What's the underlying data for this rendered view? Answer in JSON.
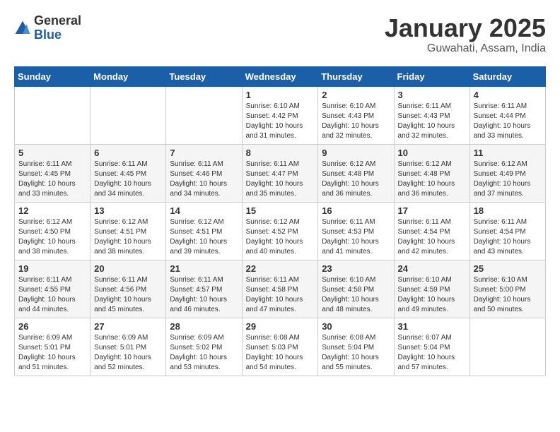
{
  "header": {
    "logo_general": "General",
    "logo_blue": "Blue",
    "month_title": "January 2025",
    "location": "Guwahati, Assam, India"
  },
  "weekdays": [
    "Sunday",
    "Monday",
    "Tuesday",
    "Wednesday",
    "Thursday",
    "Friday",
    "Saturday"
  ],
  "weeks": [
    [
      {
        "day": "",
        "info": ""
      },
      {
        "day": "",
        "info": ""
      },
      {
        "day": "",
        "info": ""
      },
      {
        "day": "1",
        "info": "Sunrise: 6:10 AM\nSunset: 4:42 PM\nDaylight: 10 hours\nand 31 minutes."
      },
      {
        "day": "2",
        "info": "Sunrise: 6:10 AM\nSunset: 4:43 PM\nDaylight: 10 hours\nand 32 minutes."
      },
      {
        "day": "3",
        "info": "Sunrise: 6:11 AM\nSunset: 4:43 PM\nDaylight: 10 hours\nand 32 minutes."
      },
      {
        "day": "4",
        "info": "Sunrise: 6:11 AM\nSunset: 4:44 PM\nDaylight: 10 hours\nand 33 minutes."
      }
    ],
    [
      {
        "day": "5",
        "info": "Sunrise: 6:11 AM\nSunset: 4:45 PM\nDaylight: 10 hours\nand 33 minutes."
      },
      {
        "day": "6",
        "info": "Sunrise: 6:11 AM\nSunset: 4:45 PM\nDaylight: 10 hours\nand 34 minutes."
      },
      {
        "day": "7",
        "info": "Sunrise: 6:11 AM\nSunset: 4:46 PM\nDaylight: 10 hours\nand 34 minutes."
      },
      {
        "day": "8",
        "info": "Sunrise: 6:11 AM\nSunset: 4:47 PM\nDaylight: 10 hours\nand 35 minutes."
      },
      {
        "day": "9",
        "info": "Sunrise: 6:12 AM\nSunset: 4:48 PM\nDaylight: 10 hours\nand 36 minutes."
      },
      {
        "day": "10",
        "info": "Sunrise: 6:12 AM\nSunset: 4:48 PM\nDaylight: 10 hours\nand 36 minutes."
      },
      {
        "day": "11",
        "info": "Sunrise: 6:12 AM\nSunset: 4:49 PM\nDaylight: 10 hours\nand 37 minutes."
      }
    ],
    [
      {
        "day": "12",
        "info": "Sunrise: 6:12 AM\nSunset: 4:50 PM\nDaylight: 10 hours\nand 38 minutes."
      },
      {
        "day": "13",
        "info": "Sunrise: 6:12 AM\nSunset: 4:51 PM\nDaylight: 10 hours\nand 38 minutes."
      },
      {
        "day": "14",
        "info": "Sunrise: 6:12 AM\nSunset: 4:51 PM\nDaylight: 10 hours\nand 39 minutes."
      },
      {
        "day": "15",
        "info": "Sunrise: 6:12 AM\nSunset: 4:52 PM\nDaylight: 10 hours\nand 40 minutes."
      },
      {
        "day": "16",
        "info": "Sunrise: 6:11 AM\nSunset: 4:53 PM\nDaylight: 10 hours\nand 41 minutes."
      },
      {
        "day": "17",
        "info": "Sunrise: 6:11 AM\nSunset: 4:54 PM\nDaylight: 10 hours\nand 42 minutes."
      },
      {
        "day": "18",
        "info": "Sunrise: 6:11 AM\nSunset: 4:54 PM\nDaylight: 10 hours\nand 43 minutes."
      }
    ],
    [
      {
        "day": "19",
        "info": "Sunrise: 6:11 AM\nSunset: 4:55 PM\nDaylight: 10 hours\nand 44 minutes."
      },
      {
        "day": "20",
        "info": "Sunrise: 6:11 AM\nSunset: 4:56 PM\nDaylight: 10 hours\nand 45 minutes."
      },
      {
        "day": "21",
        "info": "Sunrise: 6:11 AM\nSunset: 4:57 PM\nDaylight: 10 hours\nand 46 minutes."
      },
      {
        "day": "22",
        "info": "Sunrise: 6:11 AM\nSunset: 4:58 PM\nDaylight: 10 hours\nand 47 minutes."
      },
      {
        "day": "23",
        "info": "Sunrise: 6:10 AM\nSunset: 4:58 PM\nDaylight: 10 hours\nand 48 minutes."
      },
      {
        "day": "24",
        "info": "Sunrise: 6:10 AM\nSunset: 4:59 PM\nDaylight: 10 hours\nand 49 minutes."
      },
      {
        "day": "25",
        "info": "Sunrise: 6:10 AM\nSunset: 5:00 PM\nDaylight: 10 hours\nand 50 minutes."
      }
    ],
    [
      {
        "day": "26",
        "info": "Sunrise: 6:09 AM\nSunset: 5:01 PM\nDaylight: 10 hours\nand 51 minutes."
      },
      {
        "day": "27",
        "info": "Sunrise: 6:09 AM\nSunset: 5:01 PM\nDaylight: 10 hours\nand 52 minutes."
      },
      {
        "day": "28",
        "info": "Sunrise: 6:09 AM\nSunset: 5:02 PM\nDaylight: 10 hours\nand 53 minutes."
      },
      {
        "day": "29",
        "info": "Sunrise: 6:08 AM\nSunset: 5:03 PM\nDaylight: 10 hours\nand 54 minutes."
      },
      {
        "day": "30",
        "info": "Sunrise: 6:08 AM\nSunset: 5:04 PM\nDaylight: 10 hours\nand 55 minutes."
      },
      {
        "day": "31",
        "info": "Sunrise: 6:07 AM\nSunset: 5:04 PM\nDaylight: 10 hours\nand 57 minutes."
      },
      {
        "day": "",
        "info": ""
      }
    ]
  ]
}
